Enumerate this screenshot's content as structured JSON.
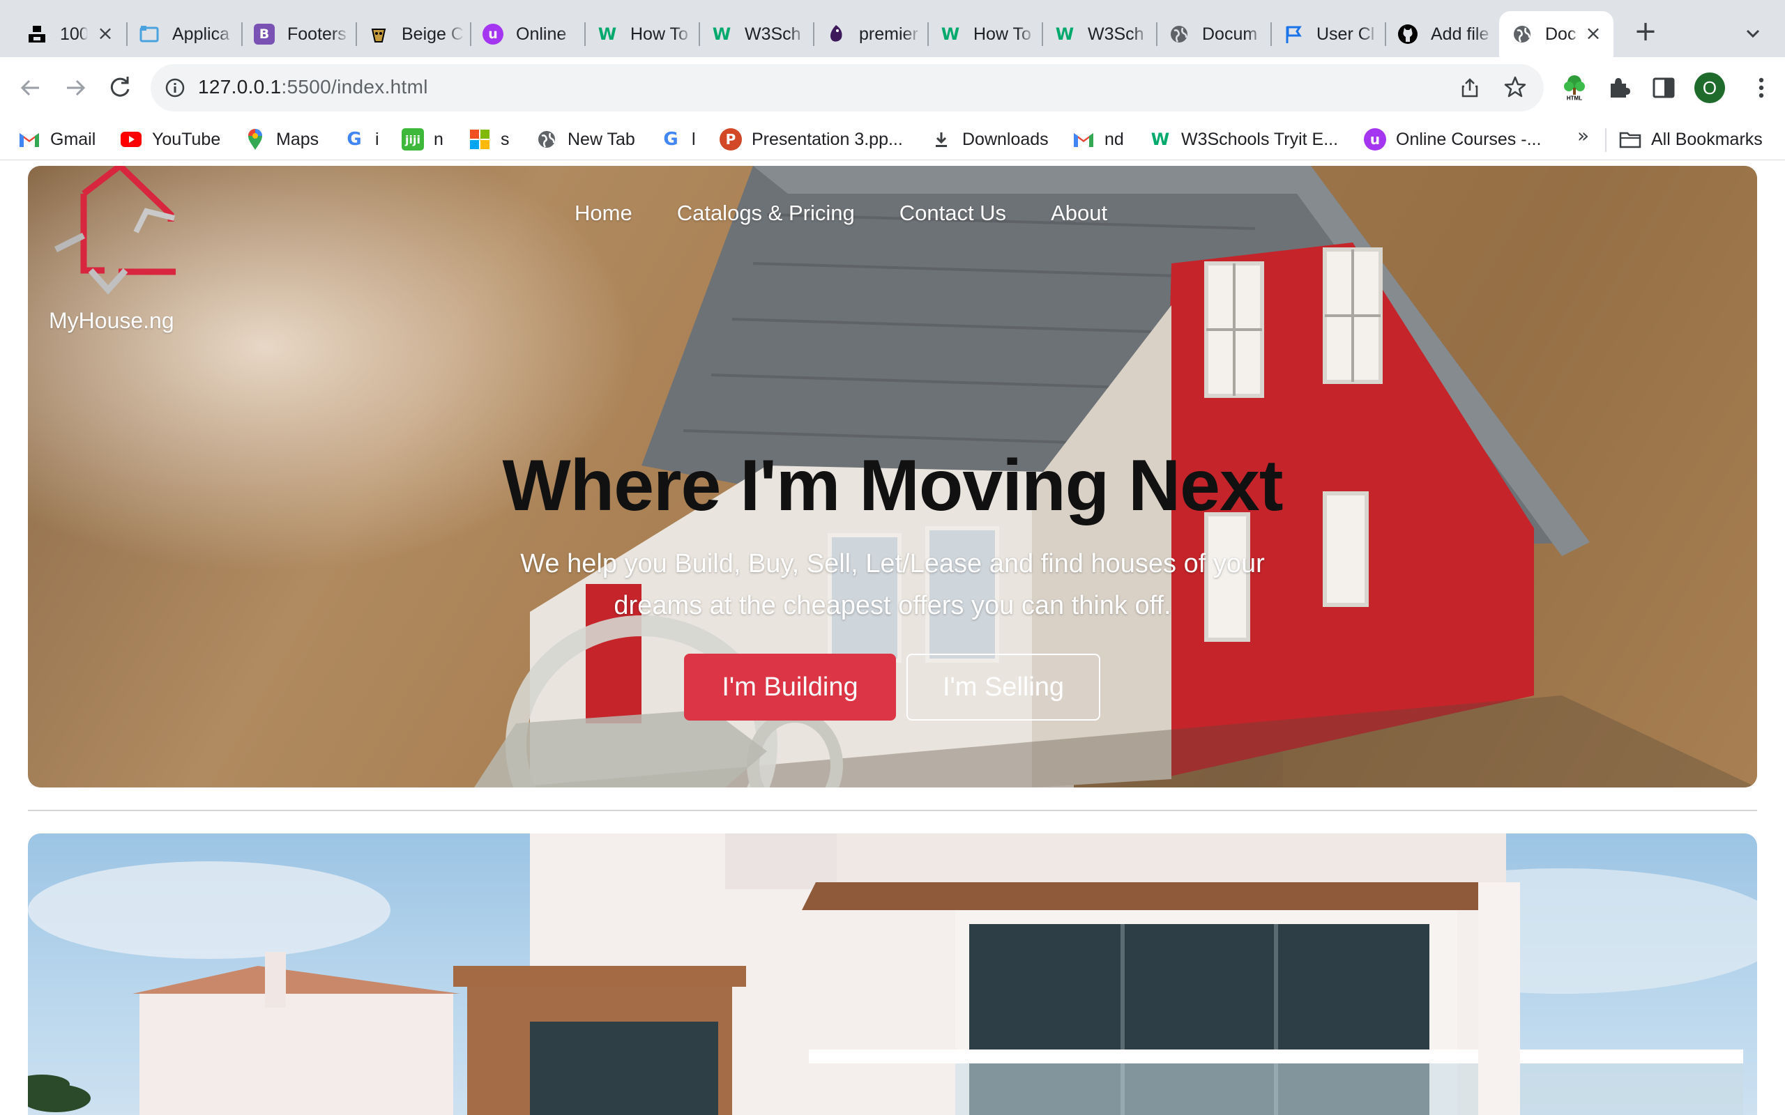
{
  "browser": {
    "tabs": [
      {
        "title": "100",
        "icon": "unsplash-icon",
        "color": "#000000"
      },
      {
        "title": "Applica",
        "icon": "app-icon",
        "color": "#4aa3df"
      },
      {
        "title": "Footers",
        "icon": "bootstrap-icon",
        "color": "#7952b3"
      },
      {
        "title": "Beige C",
        "icon": "paint-icon",
        "color": "#c49a3a"
      },
      {
        "title": "Online",
        "icon": "udemy-icon",
        "color": "#a435f0"
      },
      {
        "title": "How To",
        "icon": "w3schools-icon",
        "color": "#04aa6d"
      },
      {
        "title": "W3Sch",
        "icon": "w3schools-icon",
        "color": "#04aa6d"
      },
      {
        "title": "premier",
        "icon": "premier-league-icon",
        "color": "#3d195b"
      },
      {
        "title": "How To",
        "icon": "w3schools-icon",
        "color": "#04aa6d"
      },
      {
        "title": "W3Sch",
        "icon": "w3schools-icon",
        "color": "#04aa6d"
      },
      {
        "title": "Docum",
        "icon": "globe-icon",
        "color": "#5f6368"
      },
      {
        "title": "User Cl",
        "icon": "flag-icon",
        "color": "#1a73e8"
      },
      {
        "title": "Add file",
        "icon": "github-icon",
        "color": "#000000"
      },
      {
        "title": "Doc",
        "icon": "globe-icon",
        "color": "#5f6368"
      }
    ],
    "address": {
      "host": "127.0.0.1",
      "rest": ":5500/index.html"
    },
    "profile_initial": "O",
    "bookmarks": [
      {
        "label": "Gmail",
        "icon": "gmail-icon"
      },
      {
        "label": "YouTube",
        "icon": "youtube-icon"
      },
      {
        "label": "Maps",
        "icon": "maps-icon"
      },
      {
        "label": "i",
        "icon": "google-icon"
      },
      {
        "label": "n",
        "icon": "jiji-icon"
      },
      {
        "label": "s",
        "icon": "microsoft-icon"
      },
      {
        "label": "New Tab",
        "icon": "globe-icon"
      },
      {
        "label": "l",
        "icon": "google-icon"
      },
      {
        "label": "Presentation 3.pp...",
        "icon": "powerpoint-icon"
      },
      {
        "label": "Downloads",
        "icon": "download-icon"
      },
      {
        "label": "nd",
        "icon": "gmail-icon"
      },
      {
        "label": "W3Schools Tryit E...",
        "icon": "w3schools-icon"
      },
      {
        "label": "Online Courses -...",
        "icon": "udemy-icon"
      }
    ],
    "more_bookmarks": "»",
    "all_bookmarks": "All Bookmarks"
  },
  "site": {
    "brand": "MyHouse.ng",
    "nav": [
      "Home",
      "Catalogs & Pricing",
      "Contact Us",
      "About"
    ],
    "headline": "Where I'm Moving Next",
    "subtitle": "We help you Build, Buy, Sell, Let/Lease and find houses of your dreams at the cheapest offers you can think off.",
    "cta_primary": "I'm Building",
    "cta_secondary": "I'm Selling",
    "accent": "#dc3545"
  }
}
